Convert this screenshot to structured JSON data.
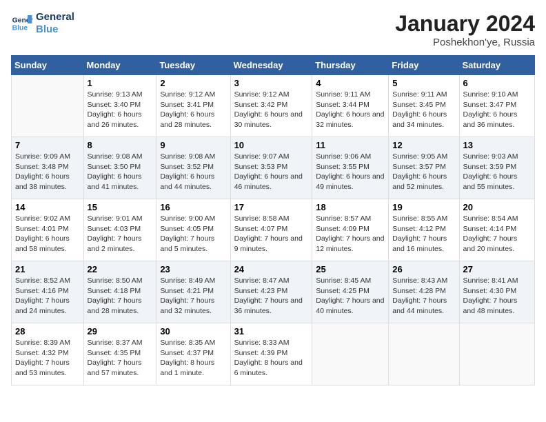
{
  "header": {
    "logo_line1": "General",
    "logo_line2": "Blue",
    "month": "January 2024",
    "location": "Poshekhon'ye, Russia"
  },
  "weekdays": [
    "Sunday",
    "Monday",
    "Tuesday",
    "Wednesday",
    "Thursday",
    "Friday",
    "Saturday"
  ],
  "weeks": [
    [
      {
        "day": "",
        "sunrise": "",
        "sunset": "",
        "daylight": ""
      },
      {
        "day": "1",
        "sunrise": "Sunrise: 9:13 AM",
        "sunset": "Sunset: 3:40 PM",
        "daylight": "Daylight: 6 hours and 26 minutes."
      },
      {
        "day": "2",
        "sunrise": "Sunrise: 9:12 AM",
        "sunset": "Sunset: 3:41 PM",
        "daylight": "Daylight: 6 hours and 28 minutes."
      },
      {
        "day": "3",
        "sunrise": "Sunrise: 9:12 AM",
        "sunset": "Sunset: 3:42 PM",
        "daylight": "Daylight: 6 hours and 30 minutes."
      },
      {
        "day": "4",
        "sunrise": "Sunrise: 9:11 AM",
        "sunset": "Sunset: 3:44 PM",
        "daylight": "Daylight: 6 hours and 32 minutes."
      },
      {
        "day": "5",
        "sunrise": "Sunrise: 9:11 AM",
        "sunset": "Sunset: 3:45 PM",
        "daylight": "Daylight: 6 hours and 34 minutes."
      },
      {
        "day": "6",
        "sunrise": "Sunrise: 9:10 AM",
        "sunset": "Sunset: 3:47 PM",
        "daylight": "Daylight: 6 hours and 36 minutes."
      }
    ],
    [
      {
        "day": "7",
        "sunrise": "Sunrise: 9:09 AM",
        "sunset": "Sunset: 3:48 PM",
        "daylight": "Daylight: 6 hours and 38 minutes."
      },
      {
        "day": "8",
        "sunrise": "Sunrise: 9:08 AM",
        "sunset": "Sunset: 3:50 PM",
        "daylight": "Daylight: 6 hours and 41 minutes."
      },
      {
        "day": "9",
        "sunrise": "Sunrise: 9:08 AM",
        "sunset": "Sunset: 3:52 PM",
        "daylight": "Daylight: 6 hours and 44 minutes."
      },
      {
        "day": "10",
        "sunrise": "Sunrise: 9:07 AM",
        "sunset": "Sunset: 3:53 PM",
        "daylight": "Daylight: 6 hours and 46 minutes."
      },
      {
        "day": "11",
        "sunrise": "Sunrise: 9:06 AM",
        "sunset": "Sunset: 3:55 PM",
        "daylight": "Daylight: 6 hours and 49 minutes."
      },
      {
        "day": "12",
        "sunrise": "Sunrise: 9:05 AM",
        "sunset": "Sunset: 3:57 PM",
        "daylight": "Daylight: 6 hours and 52 minutes."
      },
      {
        "day": "13",
        "sunrise": "Sunrise: 9:03 AM",
        "sunset": "Sunset: 3:59 PM",
        "daylight": "Daylight: 6 hours and 55 minutes."
      }
    ],
    [
      {
        "day": "14",
        "sunrise": "Sunrise: 9:02 AM",
        "sunset": "Sunset: 4:01 PM",
        "daylight": "Daylight: 6 hours and 58 minutes."
      },
      {
        "day": "15",
        "sunrise": "Sunrise: 9:01 AM",
        "sunset": "Sunset: 4:03 PM",
        "daylight": "Daylight: 7 hours and 2 minutes."
      },
      {
        "day": "16",
        "sunrise": "Sunrise: 9:00 AM",
        "sunset": "Sunset: 4:05 PM",
        "daylight": "Daylight: 7 hours and 5 minutes."
      },
      {
        "day": "17",
        "sunrise": "Sunrise: 8:58 AM",
        "sunset": "Sunset: 4:07 PM",
        "daylight": "Daylight: 7 hours and 9 minutes."
      },
      {
        "day": "18",
        "sunrise": "Sunrise: 8:57 AM",
        "sunset": "Sunset: 4:09 PM",
        "daylight": "Daylight: 7 hours and 12 minutes."
      },
      {
        "day": "19",
        "sunrise": "Sunrise: 8:55 AM",
        "sunset": "Sunset: 4:12 PM",
        "daylight": "Daylight: 7 hours and 16 minutes."
      },
      {
        "day": "20",
        "sunrise": "Sunrise: 8:54 AM",
        "sunset": "Sunset: 4:14 PM",
        "daylight": "Daylight: 7 hours and 20 minutes."
      }
    ],
    [
      {
        "day": "21",
        "sunrise": "Sunrise: 8:52 AM",
        "sunset": "Sunset: 4:16 PM",
        "daylight": "Daylight: 7 hours and 24 minutes."
      },
      {
        "day": "22",
        "sunrise": "Sunrise: 8:50 AM",
        "sunset": "Sunset: 4:18 PM",
        "daylight": "Daylight: 7 hours and 28 minutes."
      },
      {
        "day": "23",
        "sunrise": "Sunrise: 8:49 AM",
        "sunset": "Sunset: 4:21 PM",
        "daylight": "Daylight: 7 hours and 32 minutes."
      },
      {
        "day": "24",
        "sunrise": "Sunrise: 8:47 AM",
        "sunset": "Sunset: 4:23 PM",
        "daylight": "Daylight: 7 hours and 36 minutes."
      },
      {
        "day": "25",
        "sunrise": "Sunrise: 8:45 AM",
        "sunset": "Sunset: 4:25 PM",
        "daylight": "Daylight: 7 hours and 40 minutes."
      },
      {
        "day": "26",
        "sunrise": "Sunrise: 8:43 AM",
        "sunset": "Sunset: 4:28 PM",
        "daylight": "Daylight: 7 hours and 44 minutes."
      },
      {
        "day": "27",
        "sunrise": "Sunrise: 8:41 AM",
        "sunset": "Sunset: 4:30 PM",
        "daylight": "Daylight: 7 hours and 48 minutes."
      }
    ],
    [
      {
        "day": "28",
        "sunrise": "Sunrise: 8:39 AM",
        "sunset": "Sunset: 4:32 PM",
        "daylight": "Daylight: 7 hours and 53 minutes."
      },
      {
        "day": "29",
        "sunrise": "Sunrise: 8:37 AM",
        "sunset": "Sunset: 4:35 PM",
        "daylight": "Daylight: 7 hours and 57 minutes."
      },
      {
        "day": "30",
        "sunrise": "Sunrise: 8:35 AM",
        "sunset": "Sunset: 4:37 PM",
        "daylight": "Daylight: 8 hours and 1 minute."
      },
      {
        "day": "31",
        "sunrise": "Sunrise: 8:33 AM",
        "sunset": "Sunset: 4:39 PM",
        "daylight": "Daylight: 8 hours and 6 minutes."
      },
      {
        "day": "",
        "sunrise": "",
        "sunset": "",
        "daylight": ""
      },
      {
        "day": "",
        "sunrise": "",
        "sunset": "",
        "daylight": ""
      },
      {
        "day": "",
        "sunrise": "",
        "sunset": "",
        "daylight": ""
      }
    ]
  ]
}
